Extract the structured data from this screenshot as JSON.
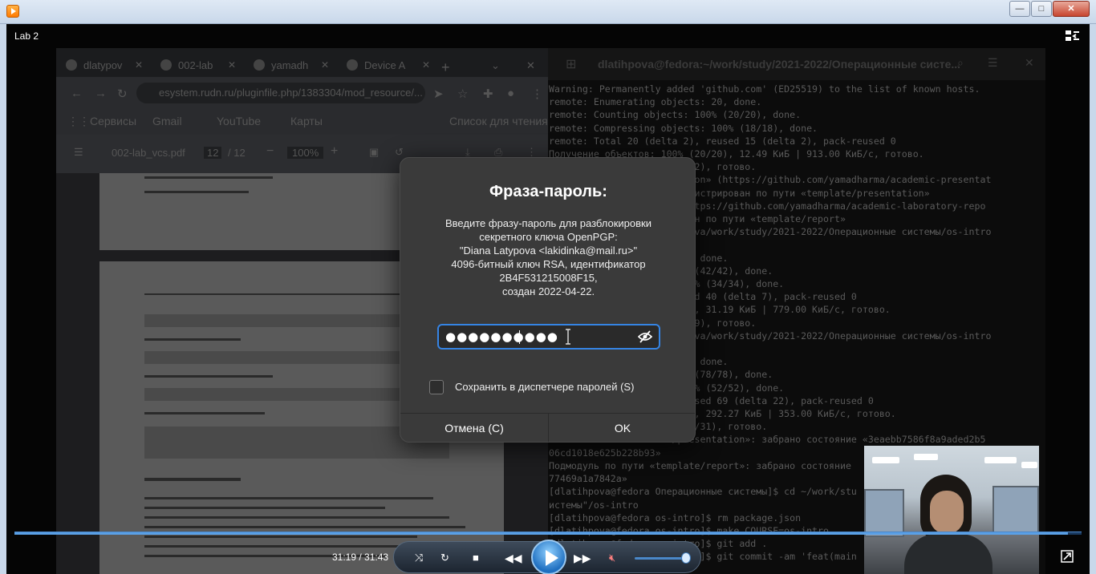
{
  "window": {
    "min_label": "—",
    "max_label": "□",
    "close_label": "✕"
  },
  "player": {
    "title": "Lab 2",
    "time": "31:19 / 31:43",
    "progress": 0.987,
    "volume": 0.9,
    "accent": "#3584e4"
  },
  "browser": {
    "tabs": [
      "dlatypov",
      "002-lab",
      "yamadh",
      "Device A"
    ],
    "url": "esystem.rudn.ru/pluginfile.php/1383304/mod_resource/...",
    "bookmarks": [
      "Сервисы",
      "Gmail",
      "YouTube",
      "Карты",
      "Список для чтения"
    ],
    "pdf_name": "002-lab_vcs.pdf",
    "pdf_page": "12",
    "pdf_pages": "/ 12",
    "pdf_zoom": "100%"
  },
  "terminal": {
    "title": "dlatihpova@fedora:~/work/study/2021-2022/Операционные систе...",
    "lines": [
      "Warning: Permanently added 'github.com' (ED25519) to the list of known hosts.",
      "remote: Enumerating objects: 20, done.",
      "remote: Counting objects: 100% (20/20), done.",
      "remote: Compressing objects: 100% (18/18), done.",
      "remote: Total 20 (delta 2), reused 15 (delta 2), pack-reused 0",
      "Получение объектов: 100% (20/20), 12.49 КиБ | 913.00 КиБ/с, готово.",
      "                    0% (2/2), готово.",
      "                    entation» (https://github.com/yamadharma/academic-presentat",
      "                     зарегистрирован по пути «template/presentation»",
      "                    t» (https://github.com/yamadharma/academic-laboratory-repo",
      "                    рирован по пути «template/report»",
      "                    atihpova/work/study/2021-2022/Операционные системы/os-intro",
      "",
      "                    s: 42, done.",
      "                     100% (42/42), done.",
      "                    s: 100% (34/34), done.",
      "                     reused 40 (delta 7), pack-reused 0",
      "                    42/42), 31.19 КиБ | 779.00 КиБ/с, готово.",
      "                    0% (9/9), готово.",
      "                    atihpova/work/study/2021-2022/Операционные системы/os-intro",
      "",
      "                    s: 78, done.",
      "                     100% (78/78), done.",
      "                    s: 100% (52/52), done.",
      "                    ), reused 69 (delta 22), pack-reused 0",
      "                    78/78), 292.27 КиБ | 353.00 КиБ/с, готово.",
      "                    0% (31/31), готово.",
      "                    ce/presentation»: забрано состояние «3eaebb7586f8a9aded2b5",
      "06cd1018e625b228b93»",
      "Подмодуль по пути «template/report»: забрано состояние",
      "77469a1a7842a»",
      "[dlatihpova@fedora Операционные системы]$ cd ~/work/stu",
      "истемы\"/os-intro",
      "[dlatihpova@fedora os-intro]$ rm package.json",
      "[dlatihpova@fedora os-intro]$ make COURSE=os-intro",
      "[dlatihpova@fedora os-intro]$ git add .",
      "[dlatihpova@fedora os-intro]$ git commit -am 'feat(main"
    ]
  },
  "dialog": {
    "title": "Фраза-пароль:",
    "message": [
      "Введите фразу-пароль для разблокировки",
      "секретного ключа OpenPGP:",
      "\"Diana Latypova <lakidinka@mail.ru>\"",
      "4096-битный ключ RSA, идентификатор",
      "2B4F531215008F15,",
      "создан 2022-04-22."
    ],
    "password_mask": "●●●●●●●●●●",
    "save_label": "Сохранить в диспетчере паролей (S)",
    "cancel_label": "Отмена (C)",
    "ok_label": "OK"
  }
}
